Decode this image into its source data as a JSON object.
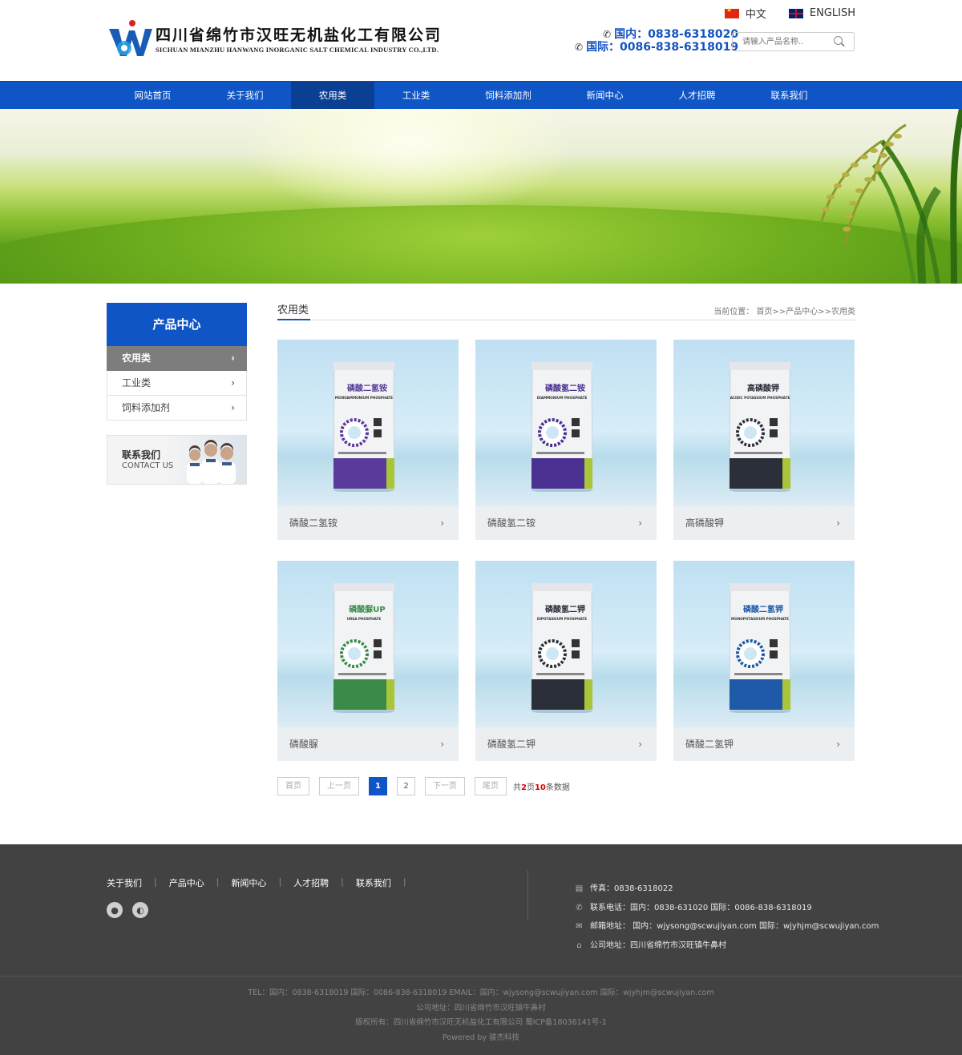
{
  "header": {
    "logo_cn": "四川省绵竹市汉旺无机盐化工有限公司",
    "logo_en": "SICHUAN MIANZHU HANWANG INORGANIC SALT CHEMICAL INDUSTRY CO.,LTD.",
    "lang_cn": "中文",
    "lang_en": "ENGLISH",
    "phone_domestic": "国内：0838-6318020",
    "phone_intl": "国际：0086-838-6318019",
    "search_placeholder": "请输入产品名称.."
  },
  "nav": [
    "网站首页",
    "关于我们",
    "农用类",
    "工业类",
    "饲料添加剂",
    "新闻中心",
    "人才招聘",
    "联系我们"
  ],
  "sidebar": {
    "title": "产品中心",
    "items": [
      {
        "label": "农用类"
      },
      {
        "label": "工业类"
      },
      {
        "label": "饲料添加剂"
      }
    ],
    "contact_cn": "联系我们",
    "contact_en": "CONTACT US"
  },
  "content": {
    "title": "农用类",
    "breadcrumb": "当前位置： 首页>>产品中心>>农用类"
  },
  "products": [
    {
      "name": "磷酸二氢铵",
      "pack_cn": "磷酸二氢铵",
      "pack_en": "MONOAMMONIUM PHOSPHATE",
      "color": "#5a3a9a"
    },
    {
      "name": "磷酸氢二铵",
      "pack_cn": "磷酸氢二铵",
      "pack_en": "DIAMMONIUM PHOSPHATE",
      "color": "#4a3090"
    },
    {
      "name": "高磷酸钾",
      "pack_cn": "高磷酸钾",
      "pack_en": "ACIDIC POTASSIUM PHOSPHATE",
      "color": "#2a2f3a"
    },
    {
      "name": "磷酸脲",
      "pack_cn": "磷酸脲UP",
      "pack_en": "UREA PHOSPHATE",
      "color": "#3a8a4a"
    },
    {
      "name": "磷酸氢二钾",
      "pack_cn": "磷酸氢二钾",
      "pack_en": "DIPOTASSIUM PHOSPHATE",
      "color": "#2a2f3a"
    },
    {
      "name": "磷酸二氢钾",
      "pack_cn": "磷酸二氢钾",
      "pack_en": "MONOPOTASSIUM PHOSPHATE",
      "color": "#1e5aa8"
    }
  ],
  "pager": {
    "first": "首页",
    "prev": "上一页",
    "page1": "1",
    "page2": "2",
    "next": "下一页",
    "last": "尾页",
    "total_prefix": "共",
    "total_pages": "2",
    "total_mid": "页",
    "total_records": "10",
    "total_suffix": "条数据"
  },
  "footer": {
    "links": [
      "关于我们",
      "产品中心",
      "新闻中心",
      "人才招聘",
      "联系我们"
    ],
    "fax": "传真：0838-6318022",
    "tel": "联系电话：国内：0838-631020 国际：0086-838-6318019",
    "email": "邮箱地址： 国内：wjysong@scwujiyan.com 国际：wjyhjm@scwujiyan.com",
    "address": "公司地址：四川省绵竹市汉旺镇牛鼻村",
    "bottom_line1": "TEL：国内：0838-6318019 国际：0086-838-6318019 EMAIL：国内：wjysong@scwujiyan.com 国际：wjyhjm@scwujiyan.com",
    "bottom_line2": "公司地址：四川省绵竹市汉旺镇牛鼻村",
    "bottom_line3": "版权所有：四川省绵竹市汉旺无机盐化工有限公司 蜀ICP备18036141号-1",
    "bottom_line4": "Powered by 骏杰科技"
  },
  "colors": {
    "primary": "#0f55c6",
    "nav_active": "#0b3f94",
    "footer_bg": "#424242"
  }
}
